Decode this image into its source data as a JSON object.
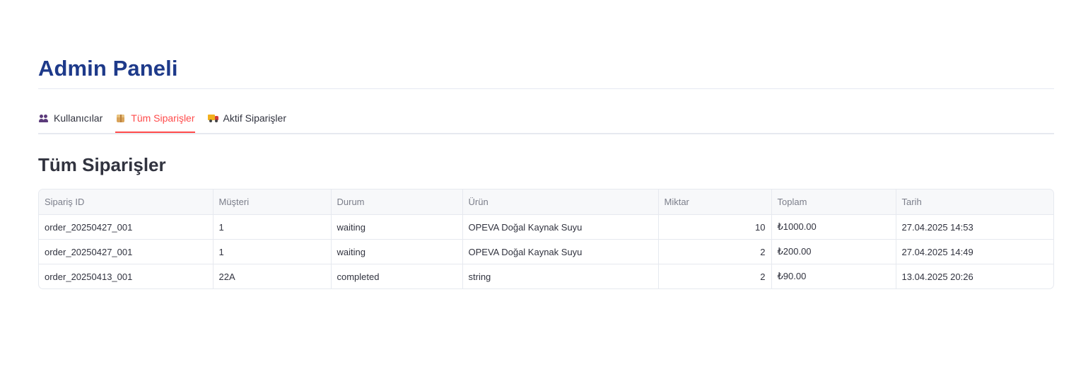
{
  "header": {
    "title": "Admin Paneli"
  },
  "tabs": [
    {
      "label": "Kullanıcılar",
      "icon": "users-icon",
      "active": false
    },
    {
      "label": "Tüm Siparişler",
      "icon": "package-icon",
      "active": true
    },
    {
      "label": "Aktif Siparişler",
      "icon": "truck-icon",
      "active": false
    }
  ],
  "section": {
    "title": "Tüm Siparişler"
  },
  "table": {
    "columns": [
      "Sipariş ID",
      "Müşteri",
      "Durum",
      "Ürün",
      "Miktar",
      "Toplam",
      "Tarih"
    ],
    "rows": [
      [
        "order_20250427_001",
        "1",
        "waiting",
        "OPEVA Doğal Kaynak Suyu",
        "10",
        "₺1000.00",
        "27.04.2025 14:53"
      ],
      [
        "order_20250427_001",
        "1",
        "waiting",
        "OPEVA Doğal Kaynak Suyu",
        "2",
        "₺200.00",
        "27.04.2025 14:49"
      ],
      [
        "order_20250413_001",
        "22A",
        "completed",
        "string",
        "2",
        "₺90.00",
        "13.04.2025 20:26"
      ]
    ]
  },
  "colors": {
    "title": "#1e3a8a",
    "accent": "#ff4b4b"
  }
}
